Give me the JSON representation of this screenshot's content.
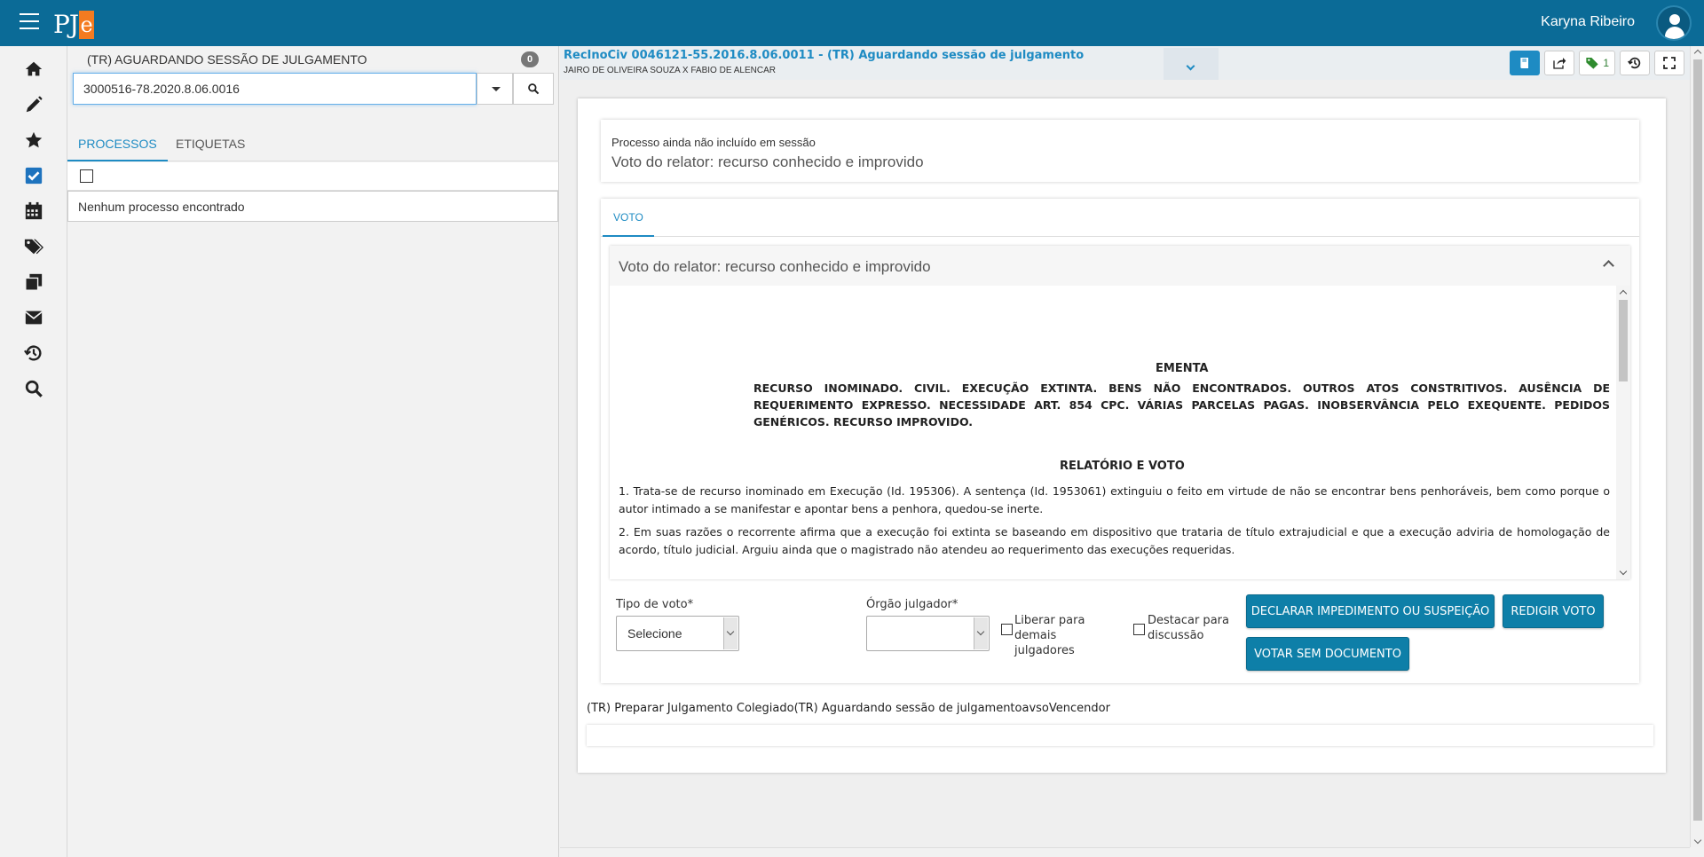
{
  "app": {
    "logo_text": "PJ",
    "logo_accent": "e",
    "user_name": "Karyna Ribeiro",
    "colors": {
      "topbar": "#0b6b97",
      "accent": "#1e8bc3",
      "logo_orange": "#f47b20"
    }
  },
  "rail": {
    "icons": [
      "home-icon",
      "pencil-icon",
      "star-icon",
      "checkbox-icon",
      "calendar-icon",
      "tags-icon",
      "copy-icon",
      "envelope-icon",
      "history-icon",
      "search-icon"
    ]
  },
  "list_panel": {
    "task_title": "(TR) AGUARDANDO SESSÃO DE JULGAMENTO",
    "count": "0",
    "search_value": "3000516-78.2020.8.06.0016",
    "tabs": [
      "PROCESSOS",
      "ETIQUETAS"
    ],
    "empty_message": "Nenhum processo encontrado"
  },
  "process": {
    "title": "RecInoCiv 0046121-55.2016.8.06.0011 - (TR) Aguardando sessão de julgamento",
    "parties": "JAIRO DE OLIVEIRA SOUZA X FABIO DE ALENCAR",
    "tag_count": "1"
  },
  "status": {
    "small": "Processo ainda não incluído em sessão",
    "big": "Voto do relator: recurso conhecido e improvido"
  },
  "voto": {
    "tab": "VOTO",
    "panel_title": "Voto do relator: recurso conhecido e improvido",
    "doc": {
      "ementa_title": "EMENTA",
      "ementa_text": "RECURSO INOMINADO. CIVIL. EXECUÇÃO EXTINTA. BENS NÃO ENCONTRADOS. OUTROS ATOS CONSTRITIVOS. AUSÊNCIA DE REQUERIMENTO EXPRESSO. NECESSIDADE ART. 854 CPC. VÁRIAS PARCELAS PAGAS. INOBSERVÂNCIA PELO EXEQUENTE. PEDIDOS GENÉRICOS. RECURSO IMPROVIDO.",
      "relatorio_title": "RELATÓRIO E VOTO",
      "para1": "1. Trata-se de recurso inominado em Execução (Id. 195306). A sentença (Id. 1953061) extinguiu o feito em virtude de não se encontrar bens penhoráveis, bem como porque o autor intimado a se manifestar e apontar bens a penhora, quedou-se inerte.",
      "para2": "2. Em suas razões o recorrente afirma que a execução foi extinta se baseando em dispositivo que trataria de título extrajudicial e que a execução adviria de homologação de acordo, título judicial. Arguiu ainda que o magistrado não atendeu ao requerimento das execuções requeridas."
    },
    "form": {
      "tipo_label": "Tipo de voto*",
      "tipo_value": "Selecione",
      "orgao_label": "Órgão julgador*",
      "orgao_value": "",
      "liberar_label": "Liberar para demais julgadores",
      "destacar_label": "Destacar para discussão",
      "btn_impedimento": "DECLARAR IMPEDIMENTO OU SUSPEIÇÃO",
      "btn_redigir": "REDIGIR VOTO",
      "btn_votar": "VOTAR SEM DOCUMENTO"
    }
  },
  "footer": {
    "flow_text": "(TR) Preparar Julgamento Colegiado(TR) Aguardando sessão de julgamentoavsoVencendor"
  }
}
